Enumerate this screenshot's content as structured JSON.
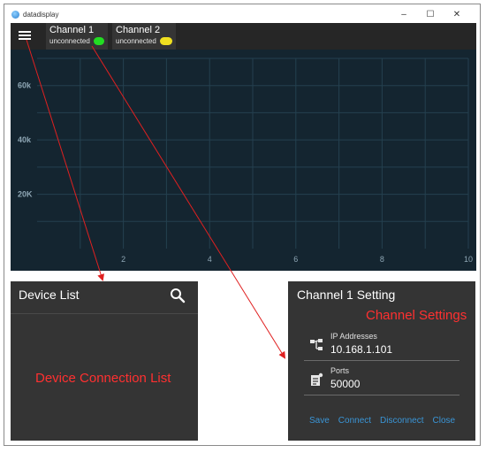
{
  "window": {
    "title": "datadisplay",
    "controls": {
      "minimize": "–",
      "maximize": "☐",
      "close": "✕"
    }
  },
  "toolbar": {
    "menu_icon": "hamburger-menu-icon",
    "channels": [
      {
        "name": "Channel 1",
        "status": "unconnected",
        "led_color": "#22dd22"
      },
      {
        "name": "Channel 2",
        "status": "unconnected",
        "led_color": "#f0e020"
      }
    ]
  },
  "chart_data": {
    "type": "line",
    "x_ticks": [
      "2",
      "4",
      "6",
      "8",
      "10"
    ],
    "y_ticks": [
      "60k",
      "40k",
      "20K"
    ],
    "xlim": [
      0,
      10
    ],
    "ylim": [
      0,
      70000
    ],
    "grid": true,
    "series": []
  },
  "device_list": {
    "title": "Device List",
    "search_icon": "search-icon",
    "annotation": "Device Connection List"
  },
  "channel_setting": {
    "title": "Channel 1 Setting",
    "annotation": "Channel Settings",
    "ip": {
      "label": "IP Addresses",
      "value": "10.168.1.101",
      "icon": "network-icon"
    },
    "port": {
      "label": "Ports",
      "value": "50000",
      "icon": "document-settings-icon"
    },
    "actions": [
      "Save",
      "Connect",
      "Disconnect",
      "Close"
    ]
  },
  "colors": {
    "app_background": "#262626",
    "chart_background": "#142530",
    "annotation": "#ff3030",
    "action_link": "#3a95d6"
  }
}
